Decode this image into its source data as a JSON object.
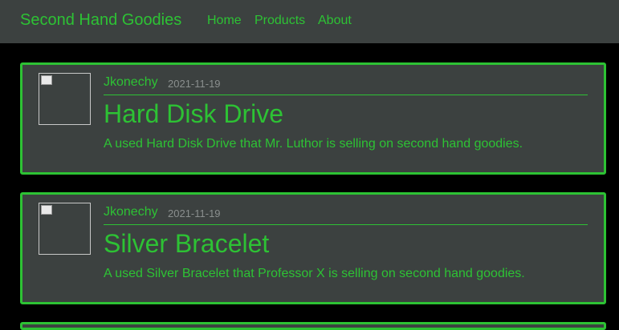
{
  "navbar": {
    "brand": "Second Hand Goodies",
    "links": [
      "Home",
      "Products",
      "About"
    ]
  },
  "posts": [
    {
      "author": "Jkonechy",
      "date": "2021-11-19",
      "title": "Hard Disk Drive",
      "description": "A used Hard Disk Drive that Mr. Luthor is selling on second hand goodies."
    },
    {
      "author": "Jkonechy",
      "date": "2021-11-19",
      "title": "Silver Bracelet",
      "description": "A used Silver Bracelet that Professor X is selling on second hand goodies."
    }
  ],
  "colors": {
    "accent": "#2dc234",
    "panel": "#3c4140",
    "background": "#000000",
    "muted": "#8a8f8e"
  },
  "icons": {
    "thumbnail": "broken-image-icon"
  }
}
